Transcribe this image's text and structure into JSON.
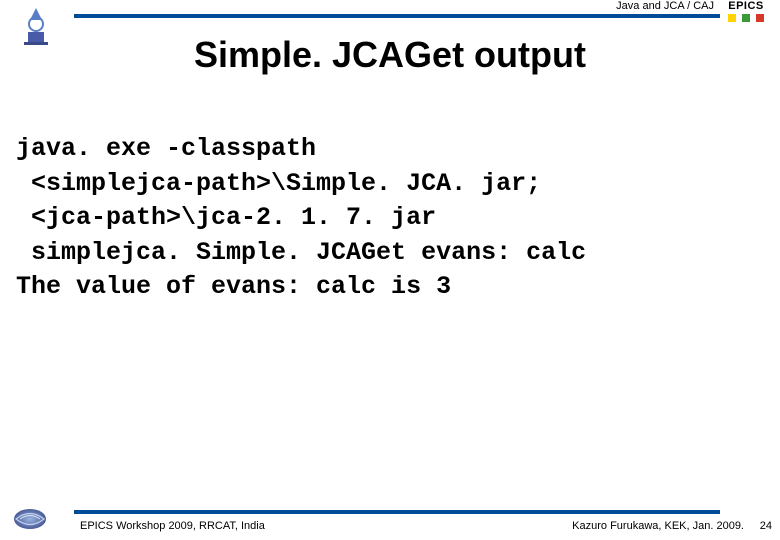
{
  "header": {
    "topic": "Java and JCA / CAJ",
    "epics_label": "EPICS"
  },
  "title": "Simple. JCAGet output",
  "code": {
    "line1": "java. exe -classpath",
    "line2": " <simplejca-path>\\Simple. JCA. jar;",
    "line3": " <jca-path>\\jca-2. 1. 7. jar",
    "line4": " simplejca. Simple. JCAGet evans: calc",
    "line5": "The value of evans: calc is 3"
  },
  "footer": {
    "left": "EPICS Workshop 2009, RRCAT, India",
    "right": "Kazuro Furukawa, KEK, Jan. 2009.",
    "page": "24"
  }
}
